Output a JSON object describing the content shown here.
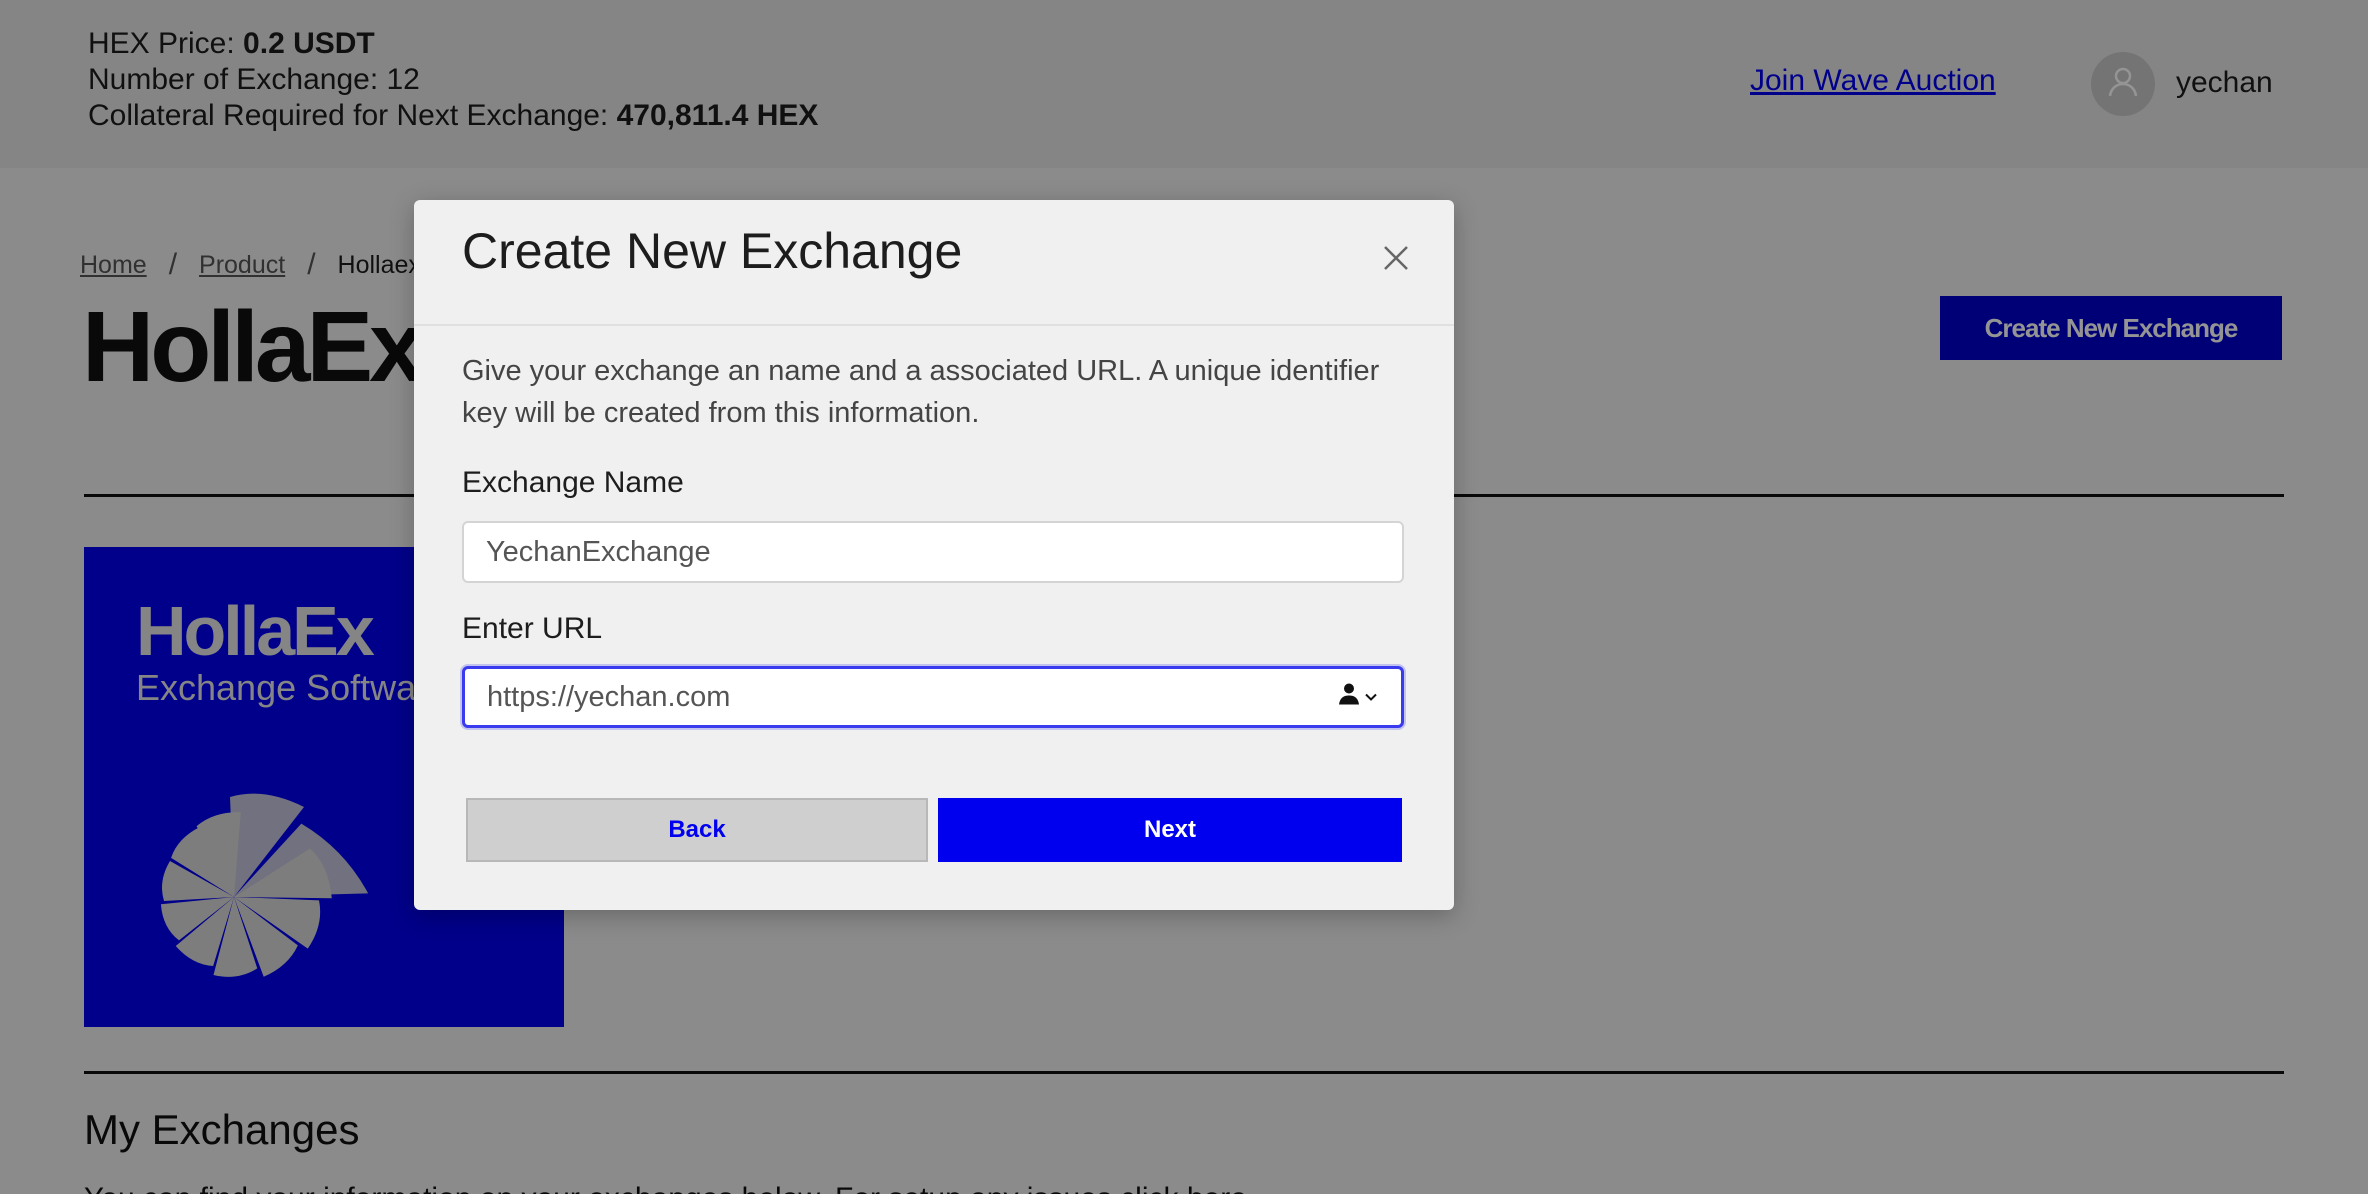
{
  "header": {
    "hex_price_label": "HEX Price: ",
    "hex_price_value": "0.2 USDT",
    "exchange_count_label": "Number of Exchange: 12",
    "collateral_label": "Collateral Required for Next Exchange: ",
    "collateral_value": "470,811.4 HEX",
    "join_link": "Join Wave Auction",
    "username": "yechan"
  },
  "breadcrumb": {
    "home": "Home",
    "product": "Product",
    "current": "Hollaex-"
  },
  "page": {
    "title": "HollaEx",
    "create_button": "Create New Exchange",
    "card_logo": "HollaEx",
    "card_sub": "Exchange Softwa",
    "section_title": "My Exchanges",
    "section_desc": "You can find your information on your exchanges below. For setup any issues click here."
  },
  "modal": {
    "title": "Create New Exchange",
    "description": "Give your exchange an name and a associated URL. A unique identifier key will be created from this information.",
    "name_label": "Exchange Name",
    "name_value": "YechanExchange",
    "url_label": "Enter URL",
    "url_value": "https://yechan.com",
    "back_label": "Back",
    "next_label": "Next"
  },
  "colors": {
    "brand_blue": "#0000ee",
    "overlay": "rgba(0,0,0,0.42)"
  },
  "icons": [
    "user-avatar-icon",
    "close-icon",
    "autofill-person-icon",
    "chevron-down-icon",
    "spiral-logo-icon"
  ]
}
